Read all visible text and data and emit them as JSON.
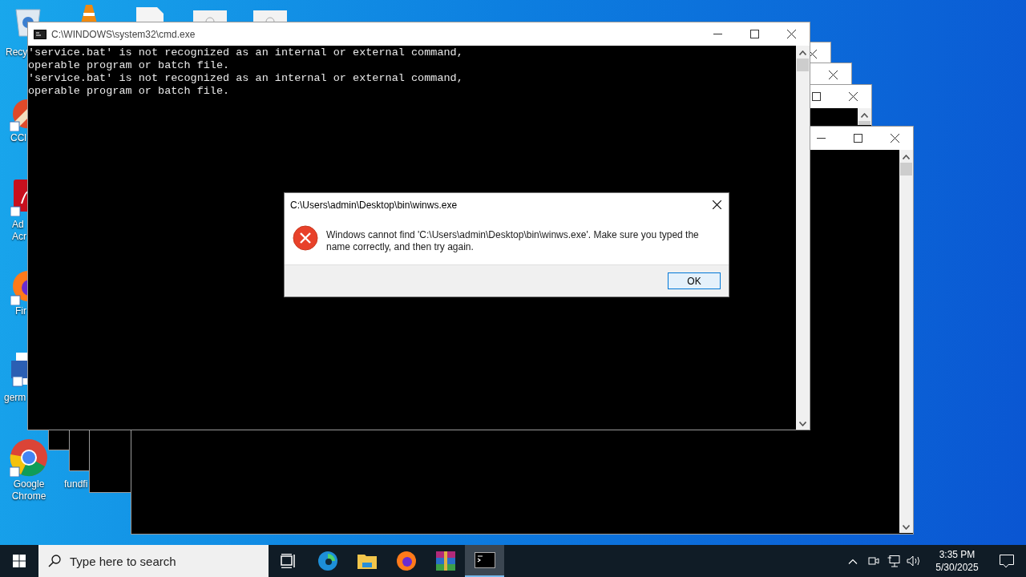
{
  "desktop_icons": [
    {
      "lines": [
        "Recy"
      ]
    },
    {
      "lines": [
        "CCl"
      ]
    },
    {
      "lines": [
        "Ad",
        "Acr"
      ]
    },
    {
      "lines": [
        "Fir"
      ]
    },
    {
      "lines": [
        "germ"
      ]
    },
    {
      "lines": [
        "Google",
        "Chrome"
      ]
    },
    {
      "lines": [
        "fundfi"
      ]
    }
  ],
  "cmd_window": {
    "title": "C:\\WINDOWS\\system32\\cmd.exe",
    "console_lines": [
      "'service.bat' is not recognized as an internal or external command,",
      "operable program or batch file.",
      "'service.bat' is not recognized as an internal or external command,",
      "operable program or batch file."
    ]
  },
  "dialog": {
    "title": "C:\\Users\\admin\\Desktop\\bin\\winws.exe",
    "message": "Windows cannot find 'C:\\Users\\admin\\Desktop\\bin\\winws.exe'. Make sure you typed the name correctly, and then try again.",
    "button": "OK"
  },
  "taskbar": {
    "search": {
      "placeholder": "Type here to search"
    },
    "apps": [
      {
        "selected": false
      },
      {
        "selected": false
      },
      {
        "selected": false
      },
      {
        "selected": false
      },
      {
        "selected": false
      },
      {
        "selected": true
      }
    ],
    "time": "3:35 PM",
    "date": "5/30/2025"
  }
}
